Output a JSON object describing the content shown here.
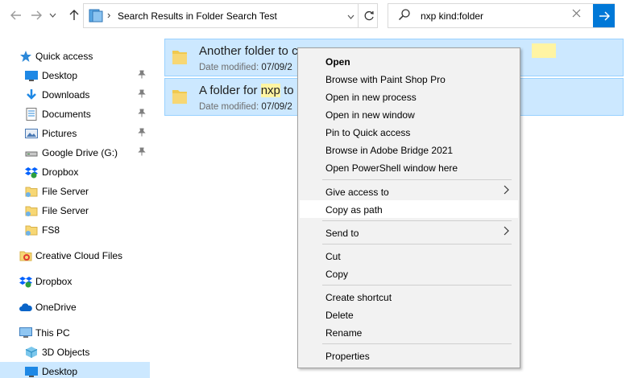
{
  "toolbar": {
    "back_icon": "back-arrow-icon",
    "forward_icon": "forward-arrow-icon",
    "recent_icon": "chevron-down-icon",
    "up_icon": "up-arrow-icon"
  },
  "address_bar": {
    "path": "Search Results in Folder Search Test",
    "separator": "›"
  },
  "search": {
    "query": "nxp kind:folder"
  },
  "sidebar": {
    "items": [
      {
        "label": "Quick access",
        "icon": "star-icon",
        "pinned": false
      },
      {
        "label": "Desktop",
        "icon": "desktop-icon",
        "pinned": true
      },
      {
        "label": "Downloads",
        "icon": "download-icon",
        "pinned": true
      },
      {
        "label": "Documents",
        "icon": "documents-icon",
        "pinned": true
      },
      {
        "label": "Pictures",
        "icon": "pictures-icon",
        "pinned": true
      },
      {
        "label": "Google Drive (G:)",
        "icon": "drive-icon",
        "pinned": true
      },
      {
        "label": "Dropbox",
        "icon": "dropbox-icon",
        "pinned": false
      },
      {
        "label": "File Server",
        "icon": "folder-icon",
        "pinned": false
      },
      {
        "label": "File Server",
        "icon": "folder-icon",
        "pinned": false
      },
      {
        "label": "FS8",
        "icon": "folder-icon",
        "pinned": false
      },
      {
        "label": "Creative Cloud Files",
        "icon": "creative-cloud-icon",
        "pinned": false
      },
      {
        "label": "Dropbox",
        "icon": "dropbox-icon",
        "pinned": false
      },
      {
        "label": "OneDrive",
        "icon": "onedrive-icon",
        "pinned": false
      },
      {
        "label": "This PC",
        "icon": "computer-icon",
        "pinned": false
      },
      {
        "label": "3D Objects",
        "icon": "cube-icon",
        "pinned": false
      },
      {
        "label": "Desktop",
        "icon": "desktop-icon",
        "pinned": false
      }
    ],
    "pin_glyph": "📌"
  },
  "results": [
    {
      "title_pre": "Another folder to c",
      "title_hl": "",
      "title_post": "",
      "meta_key": "Date modified:",
      "meta_val": "07/09/2"
    },
    {
      "title_pre": "A folder for ",
      "title_hl": "nxp",
      "title_post": " to",
      "meta_key": "Date modified:",
      "meta_val": "07/09/2"
    }
  ],
  "context_menu": {
    "items": [
      {
        "label": "Open",
        "bold": true
      },
      {
        "label": "Browse with Paint Shop Pro"
      },
      {
        "label": "Open in new process"
      },
      {
        "label": "Open in new window"
      },
      {
        "label": "Pin to Quick access"
      },
      {
        "label": "Browse in Adobe Bridge 2021"
      },
      {
        "label": "Open PowerShell window here"
      },
      {
        "label": "Give access to",
        "submenu": true
      },
      {
        "label": "Copy as path",
        "hover": true
      },
      {
        "label": "Send to",
        "submenu": true
      },
      {
        "label": "Cut"
      },
      {
        "label": "Copy"
      },
      {
        "label": "Create shortcut"
      },
      {
        "label": "Delete"
      },
      {
        "label": "Rename"
      },
      {
        "label": "Properties"
      }
    ]
  },
  "colors": {
    "accent": "#0078d7",
    "selection": "#cce8ff",
    "highlight": "#fff4a3"
  }
}
